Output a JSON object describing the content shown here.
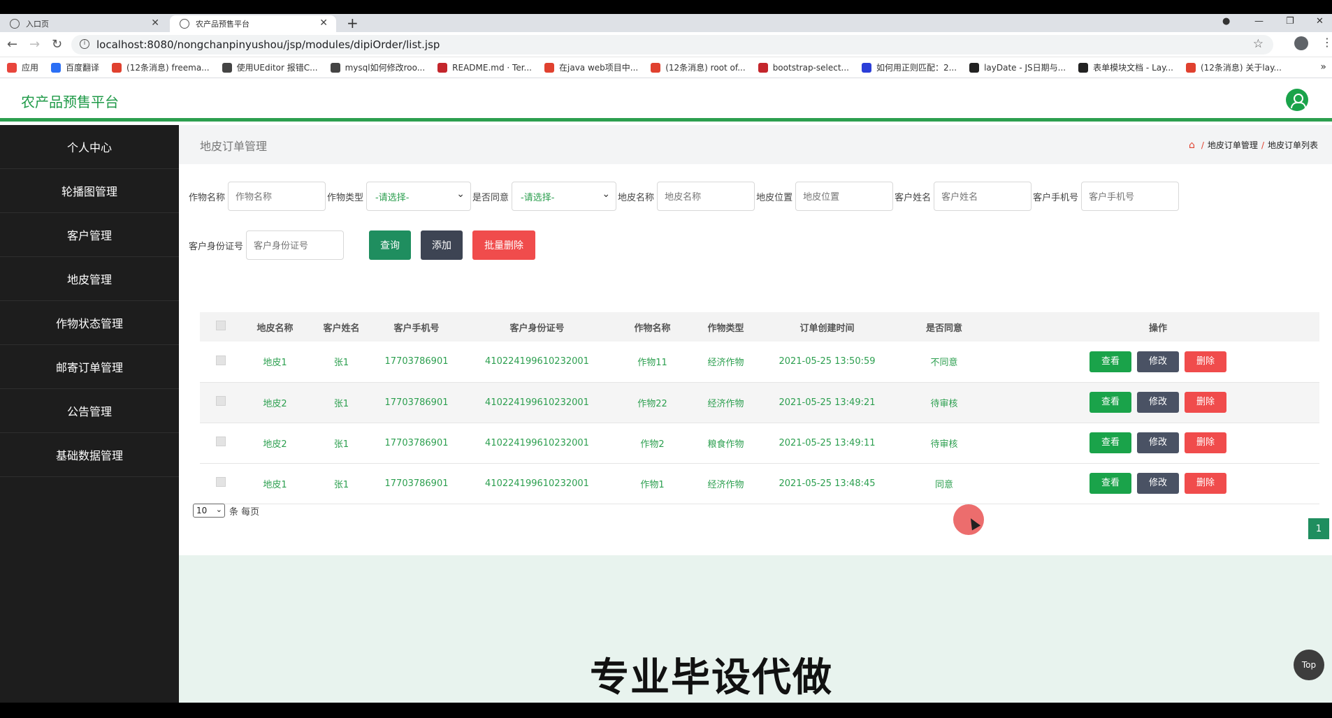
{
  "browser": {
    "tabs": [
      {
        "label": "入口页",
        "active": false
      },
      {
        "label": "农产品预售平台",
        "active": true
      }
    ],
    "url": "localhost:8080/nongchanpinyushou/jsp/modules/dipiOrder/list.jsp",
    "bookmarks": [
      {
        "label": "应用",
        "color": "#e8453c"
      },
      {
        "label": "百度翻译",
        "color": "#2b6ff5"
      },
      {
        "label": "(12条消息) freema...",
        "color": "#e0412f"
      },
      {
        "label": "使用UEditor 报错C...",
        "color": "#444444"
      },
      {
        "label": "mysql如何修改roo...",
        "color": "#444444"
      },
      {
        "label": "README.md · Ter...",
        "color": "#c4262c"
      },
      {
        "label": "在java web项目中...",
        "color": "#e0412f"
      },
      {
        "label": "(12条消息) root of...",
        "color": "#e0412f"
      },
      {
        "label": "bootstrap-select...",
        "color": "#c4262c"
      },
      {
        "label": "如何用正则匹配：2...",
        "color": "#2b3ed8"
      },
      {
        "label": "layDate - JS日期与...",
        "color": "#222222"
      },
      {
        "label": "表单模块文档 - Lay...",
        "color": "#222222"
      },
      {
        "label": "(12条消息) 关于lay...",
        "color": "#e0412f"
      }
    ]
  },
  "app": {
    "brand": "农产品预售平台",
    "accent": "#2c9f4f",
    "sidebar": [
      "个人中心",
      "轮播图管理",
      "客户管理",
      "地皮管理",
      "作物状态管理",
      "邮寄订单管理",
      "公告管理",
      "基础数据管理"
    ],
    "page_title": "地皮订单管理",
    "breadcrumb": [
      "地皮订单管理",
      "地皮订单列表"
    ],
    "filters": {
      "crop_name": {
        "label": "作物名称",
        "placeholder": "作物名称"
      },
      "crop_type": {
        "label": "作物类型",
        "value": "-请选择-"
      },
      "agree": {
        "label": "是否同意",
        "value": "-请选择-"
      },
      "land_name": {
        "label": "地皮名称",
        "placeholder": "地皮名称"
      },
      "land_location": {
        "label": "地皮位置",
        "placeholder": "地皮位置"
      },
      "customer_name": {
        "label": "客户姓名",
        "placeholder": "客户姓名"
      },
      "customer_phone": {
        "label": "客户手机号",
        "placeholder": "客户手机号"
      },
      "customer_id": {
        "label": "客户身份证号",
        "placeholder": "客户身份证号"
      }
    },
    "buttons": {
      "query": "查询",
      "add": "添加",
      "batch_delete": "批量删除"
    },
    "table": {
      "headers": [
        "地皮名称",
        "客户姓名",
        "客户手机号",
        "客户身份证号",
        "作物名称",
        "作物类型",
        "订单创建时间",
        "是否同意",
        "操作"
      ],
      "rows": [
        [
          "地皮1",
          "张1",
          "17703786901",
          "410224199610232001",
          "作物11",
          "经济作物",
          "2021-05-25 13:50:59",
          "不同意"
        ],
        [
          "地皮2",
          "张1",
          "17703786901",
          "410224199610232001",
          "作物22",
          "经济作物",
          "2021-05-25 13:49:21",
          "待审核"
        ],
        [
          "地皮2",
          "张1",
          "17703786901",
          "410224199610232001",
          "作物2",
          "粮食作物",
          "2021-05-25 13:49:11",
          "待审核"
        ],
        [
          "地皮1",
          "张1",
          "17703786901",
          "410224199610232001",
          "作物1",
          "经济作物",
          "2021-05-25 13:48:45",
          "同意"
        ]
      ],
      "actions": {
        "view": "查看",
        "edit": "修改",
        "delete": "删除"
      }
    },
    "pager": {
      "page_size": "10",
      "page_size_suffix": "条 每页",
      "current_page": "1"
    },
    "watermark": "专业毕设代做",
    "top_button": "Top"
  }
}
